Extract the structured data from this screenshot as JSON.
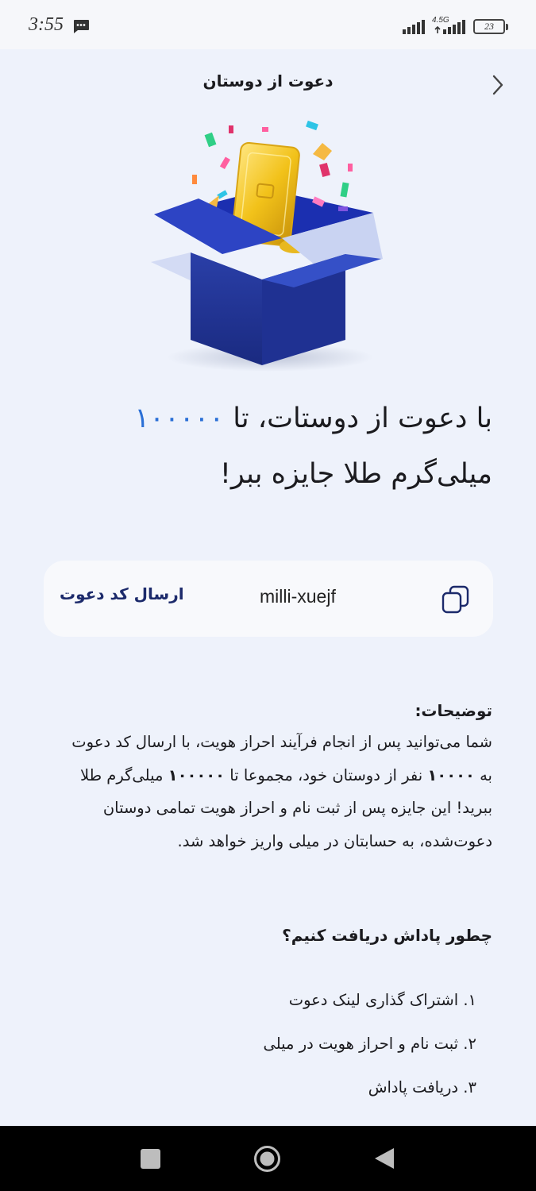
{
  "status_bar": {
    "time": "3:55",
    "network": "4.5G",
    "battery": "23",
    "icons": [
      "message-icon",
      "signal-icon",
      "signal-icon",
      "battery-icon"
    ]
  },
  "header": {
    "title": "دعوت از دوستان",
    "back_icon": "chevron-right-icon"
  },
  "hero": {
    "image": "gift-box-gold-bar-illustration"
  },
  "headline": {
    "before": "با دعوت از دوستات، تا ",
    "amount": "۱۰۰۰۰۰",
    "after": " میلی‌گرم طلا جایزه ببر!"
  },
  "invite": {
    "code": "milli-xuejf",
    "send_label": "ارسال کد دعوت",
    "copy_icon": "copy-icon"
  },
  "description": {
    "title": "توضیحات:",
    "part1": "شما می‌توانید پس از انجام فرآیند احراز هویت، با ارسال کد دعوت به ",
    "friends_count": "۱۰۰۰۰",
    "part2": " نفر از دوستان خود، مجموعا تا ",
    "total_amount": "۱۰۰۰۰۰",
    "part3": " میلی‌گرم طلا ببرید! این جایزه پس از ثبت نام و احراز هویت تمامی دوستان دعوت‌شده، به حسابتان در میلی واریز خواهد شد."
  },
  "how_to": {
    "title": "چطور پاداش دریافت کنیم؟",
    "steps": [
      "۱. اشتراک گذاری لینک دعوت",
      "۲. ثبت نام و احراز هویت در میلی",
      "۳. دریافت پاداش"
    ]
  },
  "nav": {
    "icons": [
      "recent-apps-icon",
      "home-icon",
      "back-icon"
    ]
  },
  "colors": {
    "background": "#eef2fb",
    "accent": "#2a6fd6",
    "button_text": "#1c2a6b",
    "card": "#f8f9fc"
  }
}
